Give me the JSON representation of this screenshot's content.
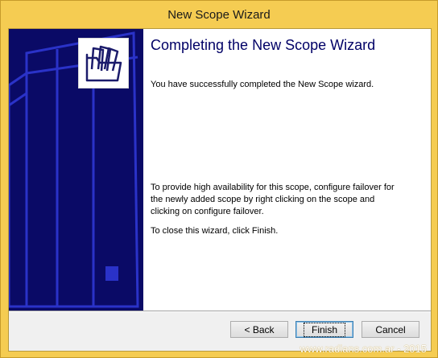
{
  "window": {
    "title": "New Scope Wizard"
  },
  "wizard": {
    "heading": "Completing the New Scope Wizard",
    "success_text": "You have successfully completed the New Scope wizard.",
    "failover_text": "To provide high availability for this scope, configure failover for the newly added scope by right clicking on the scope and clicking on configure failover.",
    "close_text": "To close this wizard, click Finish."
  },
  "buttons": {
    "back_label": "< Back",
    "finish_label": "Finish",
    "cancel_label": "Cancel"
  },
  "icons": {
    "banner_icon": "folder-icon"
  },
  "colors": {
    "banner": "#0a0a66",
    "heading": "#000066",
    "window_frame": "#f5cc52"
  },
  "watermark": "www.radians.com.ar - 2015"
}
